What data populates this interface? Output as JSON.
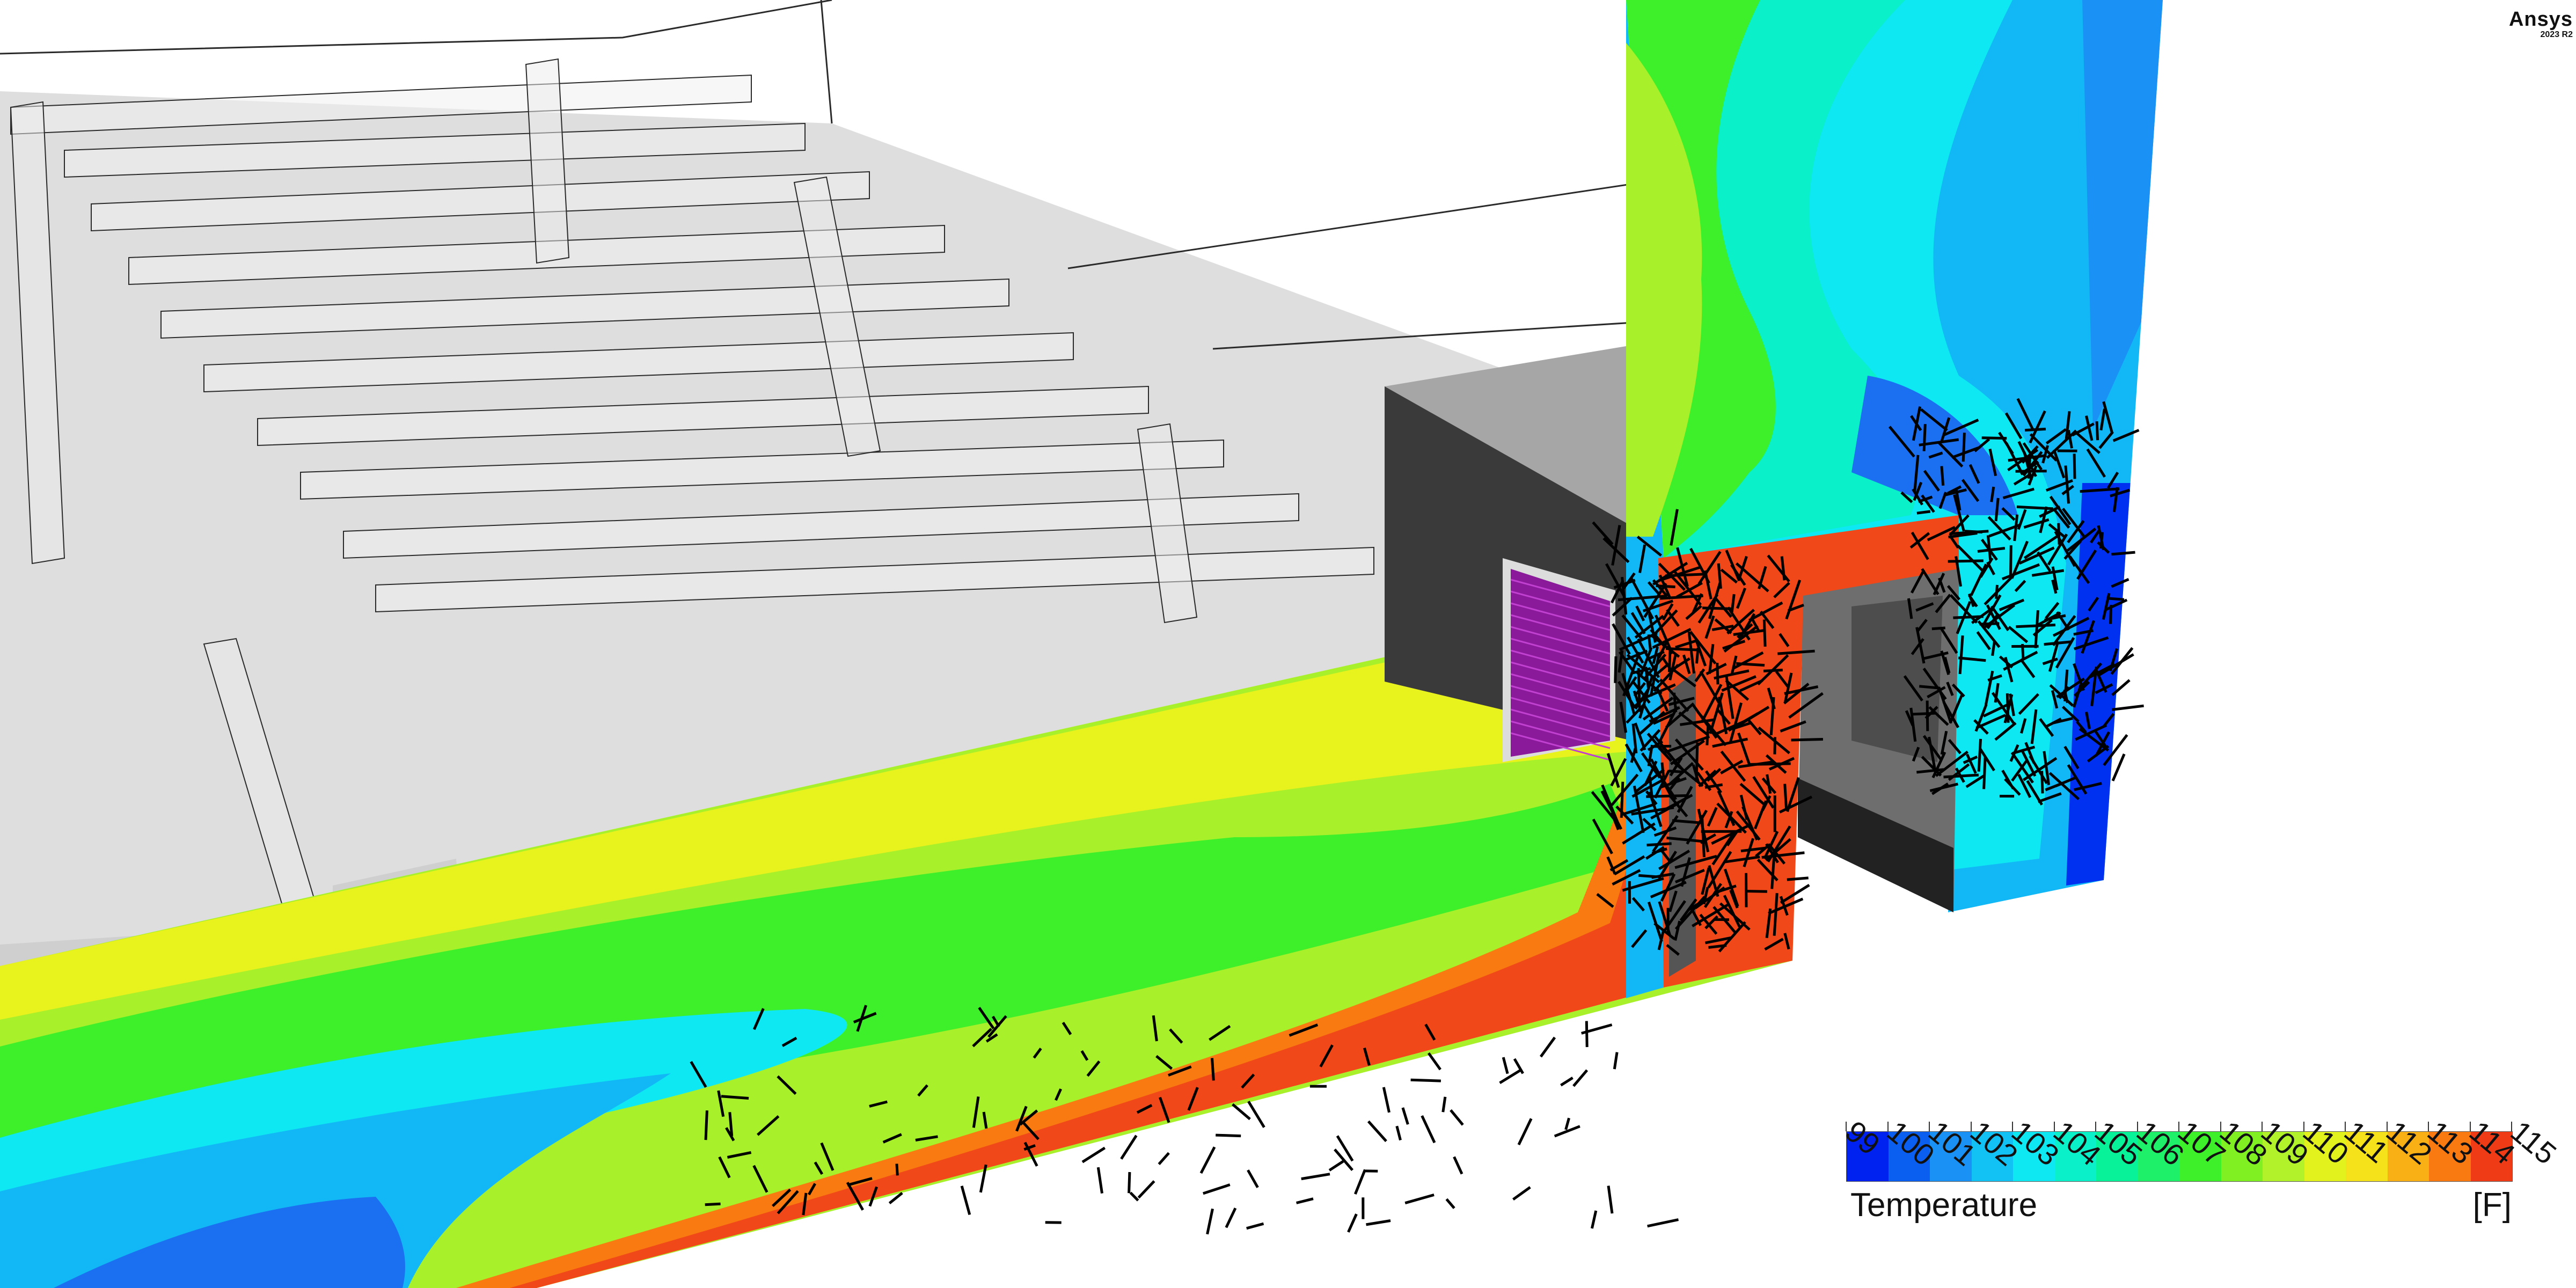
{
  "app": {
    "brand": "Ansys",
    "version": "2023 R2"
  },
  "legend": {
    "title": "Temperature",
    "unit": "[F]",
    "values": [
      "99",
      "100",
      "101",
      "102",
      "103",
      "104",
      "105",
      "106",
      "107",
      "108",
      "109",
      "110",
      "111",
      "112",
      "113",
      "114",
      "115"
    ],
    "colors": [
      "#0022f0",
      "#0a5ef0",
      "#1a92f5",
      "#12c2f5",
      "#0ee8f2",
      "#0af0c8",
      "#08f29a",
      "#1ef06a",
      "#3ef02a",
      "#80f022",
      "#b2f22a",
      "#e2f21c",
      "#f5e21a",
      "#f8b014",
      "#f87a10",
      "#f03c16"
    ]
  },
  "scene": {
    "colors": {
      "slab_top": "#dedede",
      "slab_front": "#cfcfcf",
      "wire": "#2a2a2a",
      "dark_box": "#3a3a3a",
      "dark_box_side": "#2a2a2a",
      "light_box": "#6e6e6e",
      "magenta": "#8a1a9a",
      "hot": "#f04818",
      "orange": "#f87a10",
      "yellow": "#e8f21c",
      "lime": "#a8f02a",
      "green": "#3ef02a",
      "cyan": "#0ee8f2",
      "sky": "#12b8f5",
      "blue": "#1a70f0",
      "deep_blue": "#0030f0"
    }
  }
}
